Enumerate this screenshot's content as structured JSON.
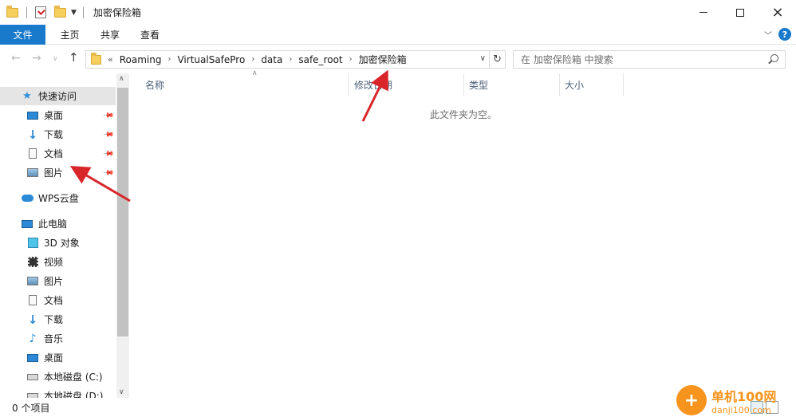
{
  "window": {
    "title": "加密保险箱",
    "quick_access_icons": [
      "folder-icon",
      "properties-check-icon",
      "new-folder-icon"
    ],
    "controls": {
      "minimize": "minimize",
      "maximize": "maximize",
      "close": "×"
    }
  },
  "ribbon": {
    "tabs": [
      "文件",
      "主页",
      "共享",
      "查看"
    ],
    "help": "?"
  },
  "address": {
    "lead": "«",
    "crumbs": [
      "Roaming",
      "VirtualSafePro",
      "data",
      "safe_root",
      "加密保险箱"
    ],
    "search_placeholder": "在 加密保险箱 中搜索"
  },
  "nav_pane": {
    "quick_access": "快速访问",
    "pinned": [
      "桌面",
      "下载",
      "文档",
      "图片"
    ],
    "wps": "WPS云盘",
    "this_pc": "此电脑",
    "pc_items": [
      "3D 对象",
      "视频",
      "图片",
      "文档",
      "下载",
      "音乐",
      "桌面",
      "本地磁盘 (C:)",
      "本地磁盘 (D:)"
    ]
  },
  "columns": {
    "name": "名称",
    "modified": "修改日期",
    "type": "类型",
    "size": "大小"
  },
  "content": {
    "empty_message": "此文件夹为空。"
  },
  "status": {
    "item_count": "0 个项目"
  },
  "watermark": {
    "main": "单机100网",
    "sub": "danji100.com"
  },
  "colors": {
    "accent": "#1979ca",
    "arrow": "#d8262b",
    "watermark": "#f7941d"
  }
}
